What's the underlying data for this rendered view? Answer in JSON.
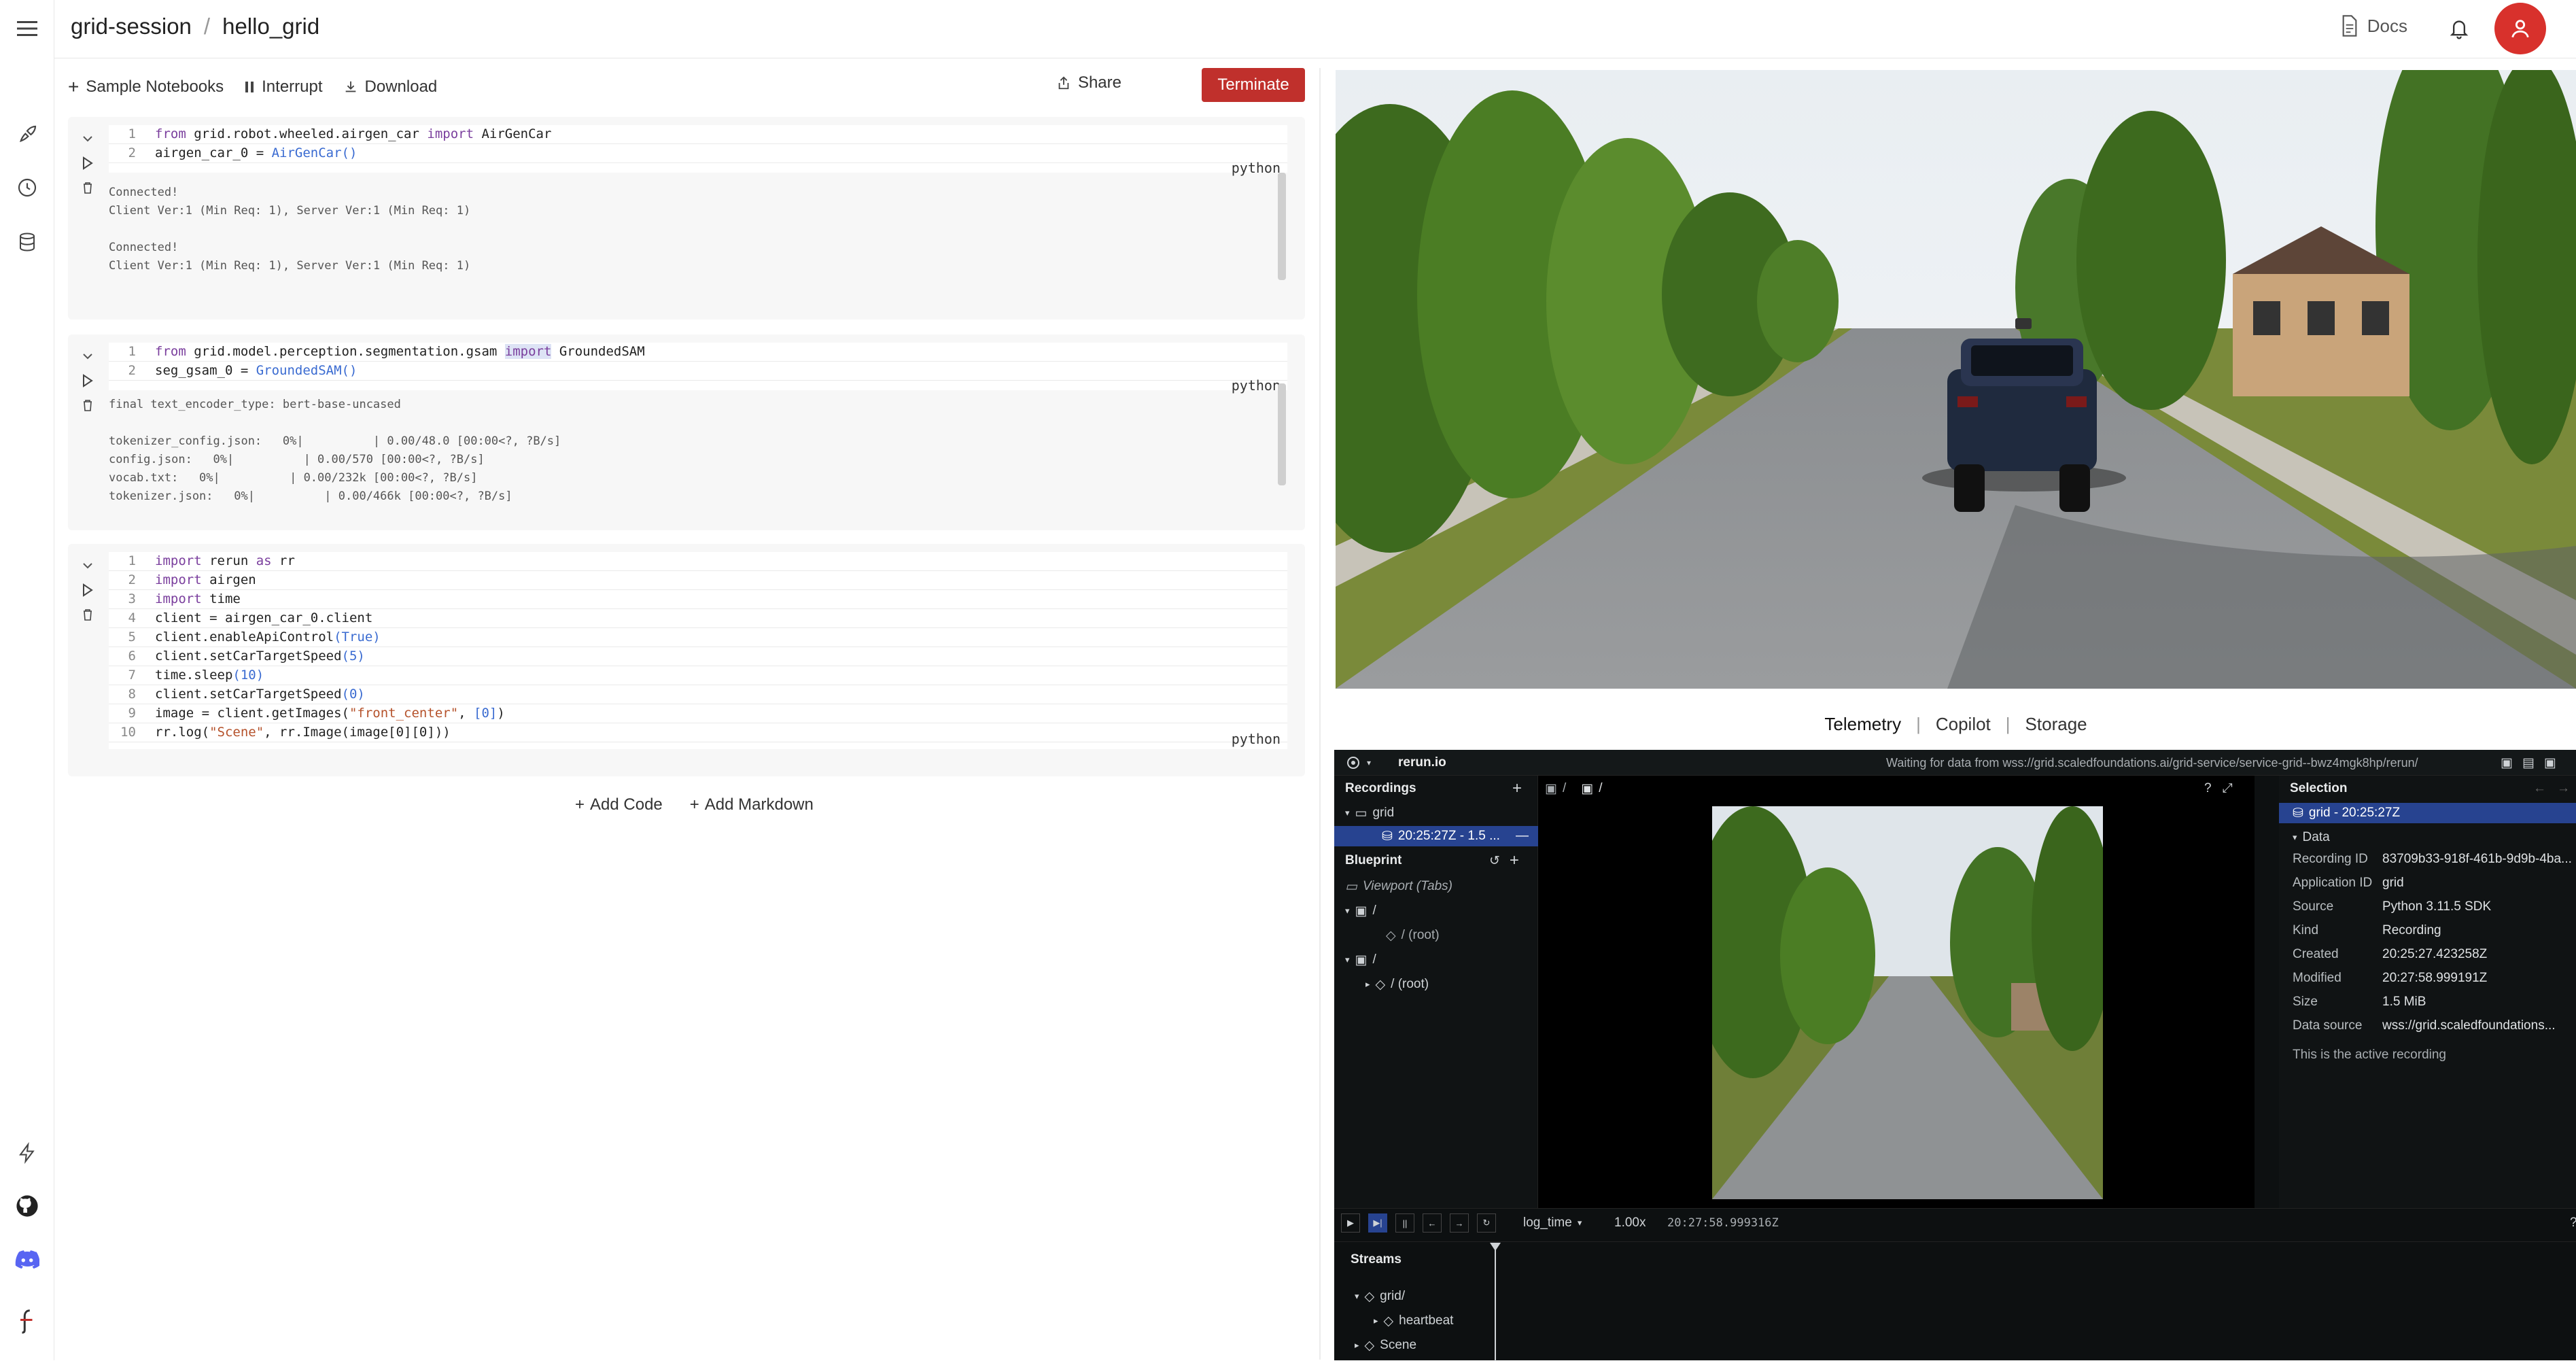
{
  "header": {
    "project": "grid-session",
    "separator": "/",
    "notebook": "hello_grid",
    "docs_label": "Docs"
  },
  "toolbar": {
    "sample_notebooks": "Sample Notebooks",
    "interrupt": "Interrupt",
    "download": "Download",
    "share": "Share",
    "terminate": "Terminate"
  },
  "cells": [
    {
      "language": "python",
      "lines": [
        {
          "n": "1",
          "text": "from grid.robot.wheeled.airgen_car import AirGenCar"
        },
        {
          "n": "2",
          "text": "airgen_car_0 = AirGenCar()"
        }
      ],
      "output": "Connected!\nClient Ver:1 (Min Req: 1), Server Ver:1 (Min Req: 1)\n\nConnected!\nClient Ver:1 (Min Req: 1), Server Ver:1 (Min Req: 1)"
    },
    {
      "language": "python",
      "lines": [
        {
          "n": "1",
          "text": "from grid.model.perception.segmentation.gsam import GroundedSAM"
        },
        {
          "n": "2",
          "text": "seg_gsam_0 = GroundedSAM()"
        }
      ],
      "output": "final text_encoder_type: bert-base-uncased\n\ntokenizer_config.json:   0%|          | 0.00/48.0 [00:00<?, ?B/s]\nconfig.json:   0%|          | 0.00/570 [00:00<?, ?B/s]\nvocab.txt:   0%|          | 0.00/232k [00:00<?, ?B/s]\ntokenizer.json:   0%|          | 0.00/466k [00:00<?, ?B/s]"
    },
    {
      "language": "python",
      "lines": [
        {
          "n": "1",
          "text": "import rerun as rr"
        },
        {
          "n": "2",
          "text": "import airgen"
        },
        {
          "n": "3",
          "text": "import time"
        },
        {
          "n": "4",
          "text": "client = airgen_car_0.client"
        },
        {
          "n": "5",
          "text": "client.enableApiControl(True)"
        },
        {
          "n": "6",
          "text": "client.setCarTargetSpeed(5)"
        },
        {
          "n": "7",
          "text": "time.sleep(10)"
        },
        {
          "n": "8",
          "text": "client.setCarTargetSpeed(0)"
        },
        {
          "n": "9",
          "text": "image = client.getImages(\"front_center\", [0])"
        },
        {
          "n": "10",
          "text": "rr.log(\"Scene\", rr.Image(image[0][0]))"
        }
      ],
      "output": ""
    }
  ],
  "add_code": "Add Code",
  "add_markdown": "Add Markdown",
  "view_tabs": {
    "telemetry": "Telemetry",
    "copilot": "Copilot",
    "storage": "Storage",
    "sep": "|"
  },
  "rerun": {
    "app_name": "rerun.io",
    "status": "Waiting for data from wss://grid.scaledfoundations.ai/grid-service/service-grid--bwz4mgk8hp/rerun/",
    "recordings_title": "Recordings",
    "recording_app": "grid",
    "recording_item": "20:25:27Z - 1.5 ...",
    "blueprint_title": "Blueprint",
    "viewport": "Viewport (Tabs)",
    "tree_root_a": "/",
    "tree_root_a_child": "/ (root)",
    "tree_root_b": "/",
    "tree_root_b_child": "/ (root)",
    "view_path_a": "/",
    "view_path_b": "/",
    "selection_title": "Selection",
    "selection_item": "grid - 20:25:27Z",
    "data_title": "Data",
    "props": [
      {
        "k": "Recording ID",
        "v": "83709b33-918f-461b-9d9b-4ba..."
      },
      {
        "k": "Application ID",
        "v": "grid"
      },
      {
        "k": "Source",
        "v": "Python 3.11.5 SDK"
      },
      {
        "k": "Kind",
        "v": "Recording"
      },
      {
        "k": "Created",
        "v": "20:25:27.423258Z"
      },
      {
        "k": "Modified",
        "v": "20:27:58.999191Z"
      },
      {
        "k": "Size",
        "v": "1.5 MiB"
      },
      {
        "k": "Data source",
        "v": "wss://grid.scaledfoundations..."
      }
    ],
    "active_note": "This is the active recording",
    "timeline": "log_time",
    "speed": "1.00x",
    "time": "20:27:58.999316Z",
    "help": "?",
    "streams_title": "Streams",
    "stream_grid": "grid/",
    "stream_heartbeat": "heartbeat",
    "stream_scene": "Scene"
  },
  "colors": {
    "accent": "#c0302c",
    "rerun_bg": "#0d1011",
    "rerun_selection": "#274390"
  }
}
